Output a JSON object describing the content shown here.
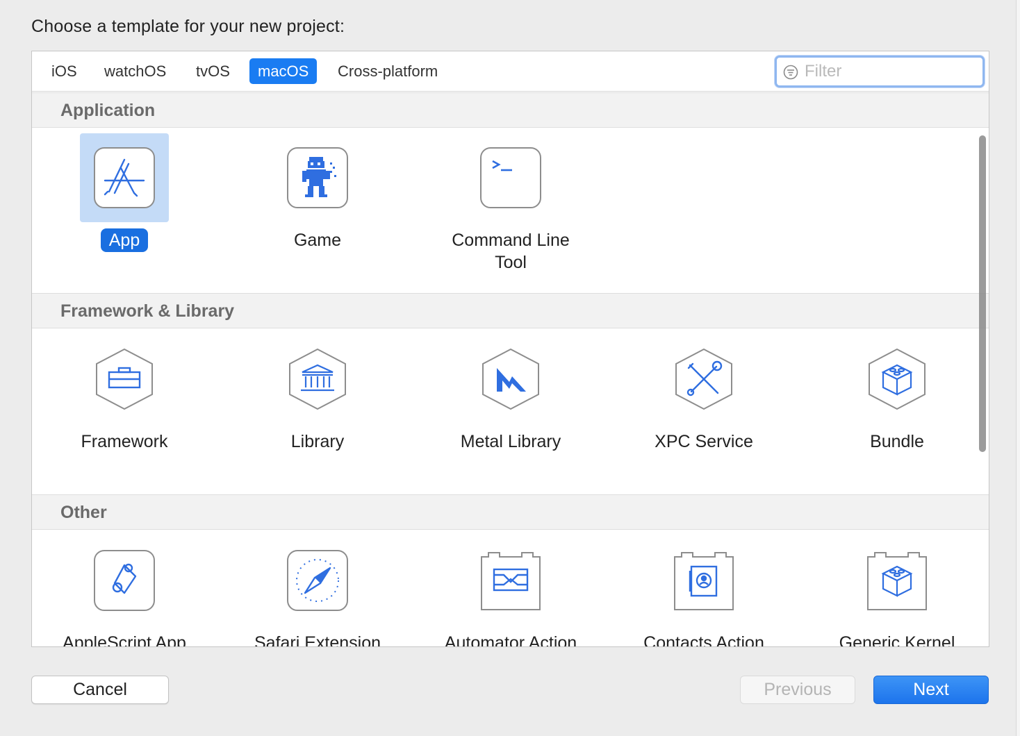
{
  "dialog": {
    "heading": "Choose a template for your new project:"
  },
  "tabs": [
    {
      "label": "iOS",
      "selected": false
    },
    {
      "label": "watchOS",
      "selected": false
    },
    {
      "label": "tvOS",
      "selected": false
    },
    {
      "label": "macOS",
      "selected": true
    },
    {
      "label": "Cross-platform",
      "selected": false
    }
  ],
  "filter": {
    "placeholder": "Filter",
    "value": ""
  },
  "sections": [
    {
      "title": "Application",
      "items": [
        {
          "label": "App",
          "icon": "app-store-icon",
          "selected": true
        },
        {
          "label": "Game",
          "icon": "game-icon",
          "selected": false
        },
        {
          "label": "Command Line Tool",
          "icon": "terminal-icon",
          "selected": false
        }
      ]
    },
    {
      "title": "Framework & Library",
      "items": [
        {
          "label": "Framework",
          "icon": "framework-toolbox-icon"
        },
        {
          "label": "Library",
          "icon": "library-building-icon"
        },
        {
          "label": "Metal Library",
          "icon": "metal-icon"
        },
        {
          "label": "XPC Service",
          "icon": "xpc-tools-icon"
        },
        {
          "label": "Bundle",
          "icon": "bundle-cube-icon"
        }
      ]
    },
    {
      "title": "Other",
      "items": [
        {
          "label": "AppleScript App",
          "icon": "applescript-scroll-icon"
        },
        {
          "label": "Safari Extension",
          "icon": "safari-compass-icon"
        },
        {
          "label": "Automator Action",
          "icon": "automator-icon"
        },
        {
          "label": "Contacts Action",
          "icon": "contacts-icon"
        },
        {
          "label": "Generic Kernel",
          "icon": "kernel-extension-icon"
        }
      ]
    }
  ],
  "buttons": {
    "cancel": "Cancel",
    "previous": "Previous",
    "next": "Next"
  },
  "colors": {
    "accent": "#1a7cf2",
    "icon_blue": "#2f6ee0",
    "selection_tile": "#c4dbf7"
  }
}
